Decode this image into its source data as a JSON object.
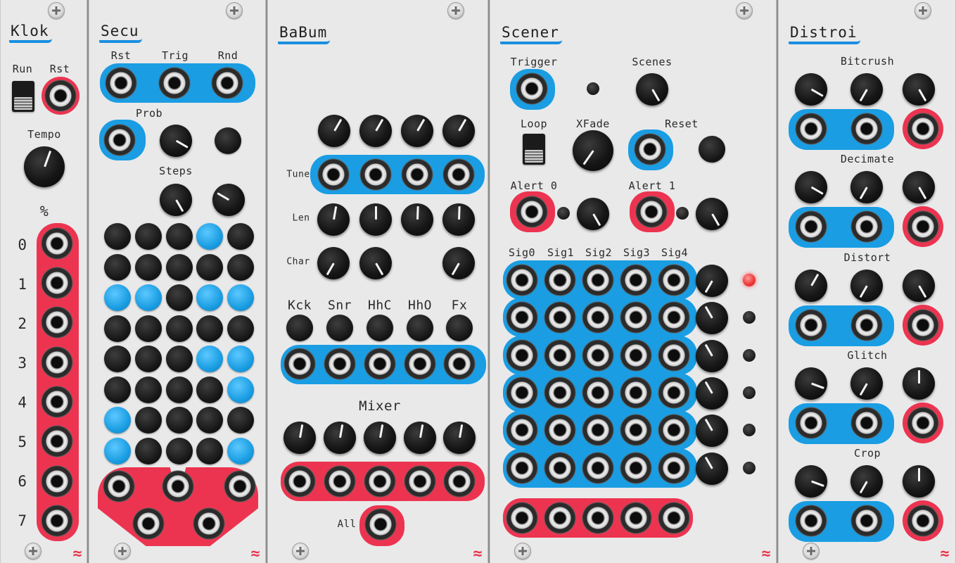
{
  "brand": {
    "logo_color": "#e8334a",
    "port_highlight_blue": "#1a9de2",
    "port_highlight_red": "#ec3450",
    "title_underline": "#1a8fe0"
  },
  "klok": {
    "title": "Klok",
    "run_label": "Run",
    "rst_label": "Rst",
    "tempo_label": "Tempo",
    "percent_label": "%",
    "output_labels": [
      "0",
      "1",
      "2",
      "3",
      "4",
      "5",
      "6",
      "7"
    ]
  },
  "secu": {
    "title": "Secu",
    "rst_label": "Rst",
    "trig_label": "Trig",
    "rnd_label": "Rnd",
    "prob_label": "Prob",
    "steps_label": "Steps",
    "step_grid_active": [
      [
        0,
        0,
        0,
        1,
        0
      ],
      [
        0,
        0,
        0,
        0,
        0
      ],
      [
        1,
        1,
        0,
        1,
        1
      ],
      [
        0,
        0,
        0,
        0,
        0
      ],
      [
        0,
        0,
        0,
        1,
        1
      ],
      [
        0,
        0,
        0,
        0,
        1
      ],
      [
        1,
        0,
        0,
        0,
        0
      ],
      [
        1,
        0,
        0,
        0,
        1
      ]
    ]
  },
  "babum": {
    "title": "BaBum",
    "tune_label": "Tune",
    "len_label": "Len",
    "char_label": "Char",
    "channel_labels": [
      "Kck",
      "Snr",
      "HhC",
      "HhO",
      "Fx"
    ],
    "mixer_label": "Mixer",
    "all_label": "All"
  },
  "scener": {
    "title": "Scener",
    "trigger_label": "Trigger",
    "scenes_label": "Scenes",
    "loop_label": "Loop",
    "xfade_label": "XFade",
    "reset_label": "Reset",
    "alert0_label": "Alert 0",
    "alert1_label": "Alert 1",
    "signal_labels": [
      "Sig0",
      "Sig1",
      "Sig2",
      "Sig3",
      "Sig4"
    ],
    "scene_led_active": [
      true,
      false,
      false,
      false,
      false,
      false
    ]
  },
  "distroi": {
    "title": "Distroi",
    "effect_labels": [
      "Bitcrush",
      "Decimate",
      "Distort",
      "Glitch",
      "Crop"
    ]
  },
  "logo_glyph": "≈"
}
